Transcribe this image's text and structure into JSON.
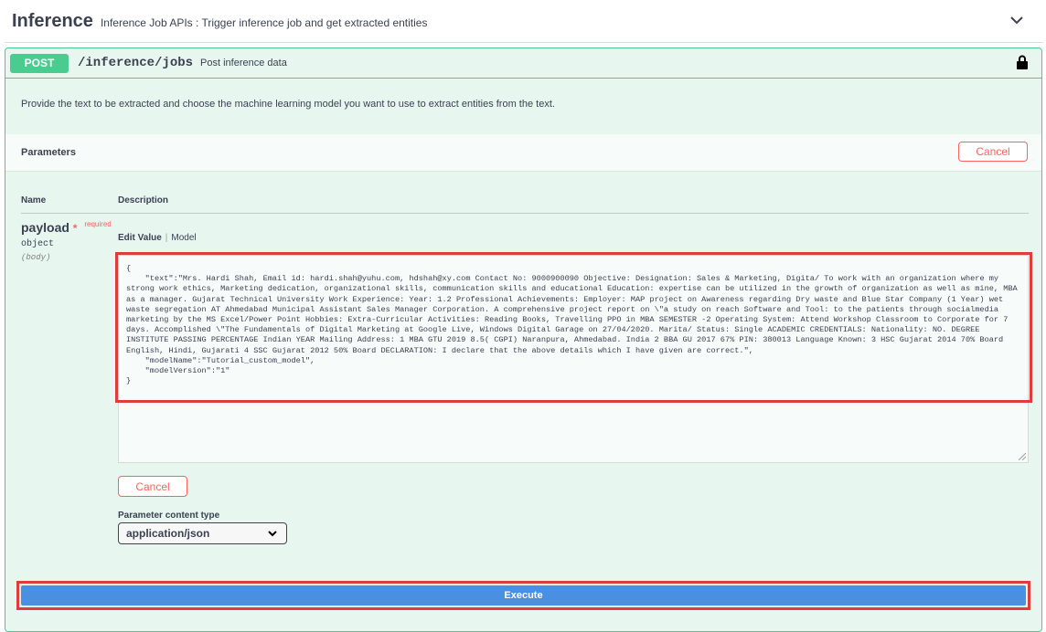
{
  "tag": {
    "title": "Inference",
    "description": "Inference Job APIs : Trigger inference job and get extracted entities",
    "chevron_icon": "chevron-down-icon"
  },
  "operation": {
    "method": "POST",
    "path": "/inference/jobs",
    "summary": "Post inference data",
    "lock_icon": "lock-icon",
    "description": "Provide the text to be extracted and choose the machine learning model you want to use to extract entities from the text."
  },
  "parameters": {
    "title": "Parameters",
    "cancel_label": "Cancel",
    "col_name": "Name",
    "col_description": "Description",
    "payload": {
      "name": "payload",
      "required_star": "*",
      "required_label": "required",
      "type": "object",
      "in": "(body)"
    },
    "tabs": {
      "edit_value": "Edit Value",
      "separator": "|",
      "model": "Model"
    },
    "body_value": "{\n    \"text\":\"Mrs. Hardi Shah, Email id: hardi.shah@yuhu.com, hdshah@xy.com Contact No: 9000900090 Objective: Designation: Sales & Marketing, Digita/ To work with an organization where my strong work ethics, Marketing dedication, organizational skills, communication skills and educational Education: expertise can be utilized in the growth of organization as well as mine, MBA as a manager. Gujarat Technical University Work Experience: Year: 1.2 Professional Achievements: Employer: MAP project on Awareness regarding Dry waste and Blue Star Company (1 Year) wet waste segregation AT Ahmedabad Municipal Assistant Sales Manager Corporation. A comprehensive project report on \\\"a study on reach Software and Tool: to the patients through socialmedia marketing by the MS Excel/Power Point Hobbies: Extra-Curricular Activities: Reading Books, Travelling PPO in MBA SEMESTER -2 Operating System: Attend Workshop Classroom to Corporate for 7 days. Accomplished \\\"The Fundamentals of Digital Marketing at Google Live, Windows Digital Garage on 27/04/2020. Marita/ Status: Single ACADEMIC CREDENTIALS: Nationality: NO. DEGREE INSTITUTE PASSING PERCENTAGE Indian YEAR Mailing Address: 1 MBA GTU 2019 8.5( CGPI) Naranpura, Ahmedabad. India 2 BBA GU 2017 67% PIN: 380013 Language Known: 3 HSC Gujarat 2014 70% Board English, Hindi, Gujarati 4 SSC Gujarat 2012 50% Board DECLARATION: I declare that the above details which I have given are correct.\",\n    \"modelName\":\"Tutorial_custom_model\",\n    \"modelVersion\":\"1\"\n}",
    "cancel_bottom_label": "Cancel",
    "content_type_label": "Parameter content type",
    "content_type_value": "application/json"
  },
  "execute_label": "Execute",
  "colors": {
    "post_green": "#49cc90",
    "cancel_red": "#ff6060",
    "execute_blue": "#4990e2",
    "highlight_red": "#e03c3c"
  }
}
